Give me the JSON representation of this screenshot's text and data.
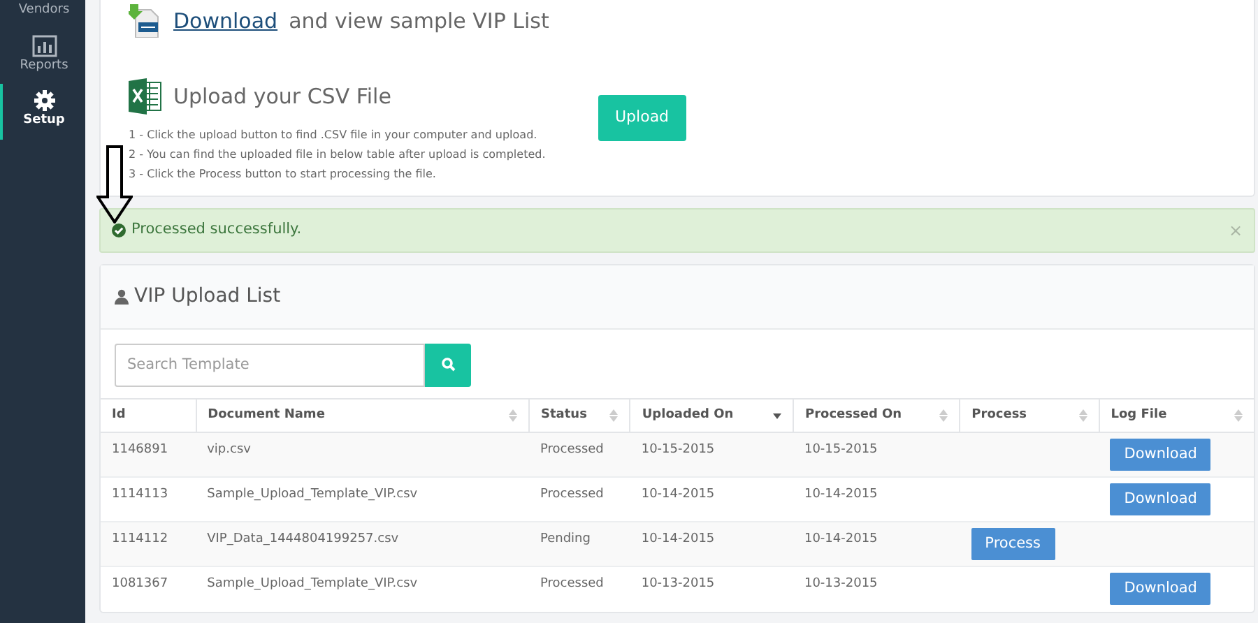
{
  "sidebar": {
    "items": [
      {
        "label": "Vendors",
        "selected": false
      },
      {
        "label": "Reports",
        "selected": false
      },
      {
        "label": "Setup",
        "selected": true
      }
    ]
  },
  "download_section": {
    "link": "Download",
    "text": "and view sample VIP List"
  },
  "upload_section": {
    "title": "Upload your CSV File",
    "button": "Upload",
    "steps": [
      "1 - Click the upload button to find .CSV file in your computer and upload.",
      "2 - You can find the uploaded file in below table after upload is completed.",
      "3 - Click the Process button to start processing the file."
    ]
  },
  "alert": {
    "text": "Processed successfully.",
    "close": "×"
  },
  "list": {
    "title": "VIP Upload List",
    "search": {
      "placeholder": "Search Template"
    },
    "table": {
      "columns": [
        {
          "label": "Id",
          "sortable": false,
          "selected": false
        },
        {
          "label": "Document Name",
          "sortable": true,
          "selected": false
        },
        {
          "label": "Status",
          "sortable": true,
          "selected": false
        },
        {
          "label": "Uploaded On",
          "sortable": true,
          "selected": true
        },
        {
          "label": "Processed On",
          "sortable": true,
          "selected": false
        },
        {
          "label": "Process",
          "sortable": true,
          "selected": false
        },
        {
          "label": "Log File",
          "sortable": true,
          "selected": false
        }
      ],
      "rows": [
        {
          "id": "1146891",
          "document_name": "vip.csv",
          "status": "Processed",
          "uploaded_on": "10-15-2015",
          "processed_on": "10-15-2015",
          "log_file": "Download"
        },
        {
          "id": "1114113",
          "document_name": "Sample_Upload_Template_VIP.csv",
          "status": "Processed",
          "uploaded_on": "10-14-2015",
          "processed_on": "10-14-2015",
          "log_file": "Download"
        },
        {
          "id": "1114112",
          "document_name": "VIP_Data_1444804199257.csv",
          "status": "Pending",
          "uploaded_on": "10-14-2015",
          "processed_on": "10-14-2015",
          "process": "Process"
        },
        {
          "id": "1081367",
          "document_name": "Sample_Upload_Template_VIP.csv",
          "status": "Processed",
          "uploaded_on": "10-13-2015",
          "processed_on": "10-13-2015",
          "log_file": "Download"
        }
      ]
    }
  }
}
